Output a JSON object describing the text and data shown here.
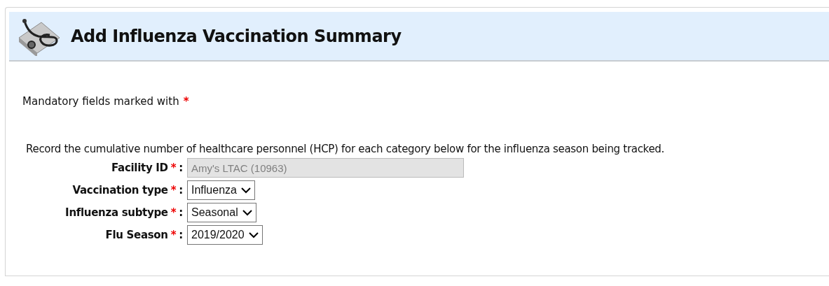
{
  "header": {
    "title": "Add Influenza Vaccination Summary"
  },
  "mandatory_note": {
    "text": "Mandatory fields marked with",
    "marker": "*"
  },
  "instructions": "Record the cumulative number of healthcare personnel (HCP) for each category below for the influenza season being tracked.",
  "fields": [
    {
      "label": "Facility ID",
      "marker": "*",
      "suffix": ":",
      "kind": "text",
      "value": "Amy's LTAC (10963)",
      "disabled": true
    },
    {
      "label": "Vaccination type",
      "marker": "*",
      "suffix": ":",
      "kind": "select",
      "value": "Influenza",
      "disabled": false
    },
    {
      "label": "Influenza subtype",
      "marker": "*",
      "suffix": ":",
      "kind": "select",
      "value": "Seasonal",
      "disabled": false
    },
    {
      "label": "Flu Season",
      "marker": "*",
      "suffix": ":",
      "kind": "select",
      "value": "2019/2020",
      "disabled": false
    }
  ]
}
